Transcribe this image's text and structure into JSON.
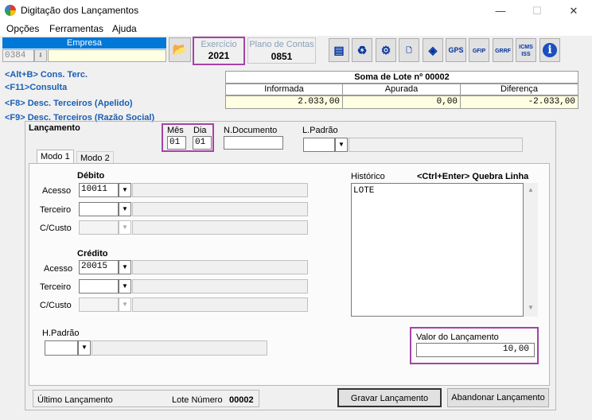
{
  "window": {
    "title": "Digitação dos Lançamentos",
    "minimize": "—",
    "maximize": "☐",
    "close": "✕"
  },
  "menu": [
    "Opções",
    "Ferramentas",
    "Ajuda"
  ],
  "empresa": {
    "header": "Empresa",
    "code": "0384"
  },
  "exercicio": {
    "label": "Exercício",
    "value": "2021"
  },
  "plano": {
    "label": "Plano de Contas",
    "value": "0851"
  },
  "toolbar": [
    {
      "name": "report-icon",
      "glyph": "▤"
    },
    {
      "name": "recycle-icon",
      "glyph": "♻"
    },
    {
      "name": "settings-icon",
      "glyph": "⚙"
    },
    {
      "name": "document-icon",
      "glyph": "🗋"
    },
    {
      "name": "diamond-icon",
      "glyph": "◈"
    },
    {
      "name": "gps-icon",
      "glyph": "GPS"
    },
    {
      "name": "gfip-icon",
      "glyph": "GFIP"
    },
    {
      "name": "grrf-icon",
      "glyph": "GRRF"
    },
    {
      "name": "icms-iss-icon",
      "glyph": "ICMS ISS"
    },
    {
      "name": "info-icon",
      "glyph": "i"
    }
  ],
  "hints": [
    "<Alt+B> Cons. Terc.",
    "<F11>Consulta",
    "<F8> Desc. Terceiros (Apelido)",
    "<F9> Desc. Terceiros (Razão Social)"
  ],
  "soma": {
    "title": "Soma de Lote nº 00002",
    "columns": [
      "Informada",
      "Apurada",
      "Diferença"
    ],
    "values": [
      "2.033,00",
      "0,00",
      "-2.033,00"
    ]
  },
  "lancamento": {
    "title": "Lançamento",
    "mes_label": "Mês",
    "mes": "01",
    "dia_label": "Dia",
    "dia": "01",
    "ndoc_label": "N.Documento",
    "lpadrao_label": "L.Padrão"
  },
  "tabs": [
    "Modo 1",
    "Modo 2"
  ],
  "debito": {
    "title": "Débito",
    "acesso_label": "Acesso",
    "acesso": "10011",
    "terceiro_label": "Terceiro",
    "ccusto_label": "C/Custo"
  },
  "credito": {
    "title": "Crédito",
    "acesso_label": "Acesso",
    "acesso": "20015",
    "terceiro_label": "Terceiro",
    "ccusto_label": "C/Custo"
  },
  "historico": {
    "label": "Histórico",
    "hint": "<Ctrl+Enter> Quebra Linha",
    "text": "LOTE"
  },
  "hpadrao_label": "H.Padrão",
  "valor": {
    "label": "Valor do Lançamento",
    "value": "10,00"
  },
  "status": {
    "ultimo_label": "Último Lançamento",
    "lote_label": "Lote Número",
    "lote_value": "00002"
  },
  "actions": {
    "gravar": "Gravar Lançamento",
    "abandonar": "Abandonar Lançamento"
  }
}
